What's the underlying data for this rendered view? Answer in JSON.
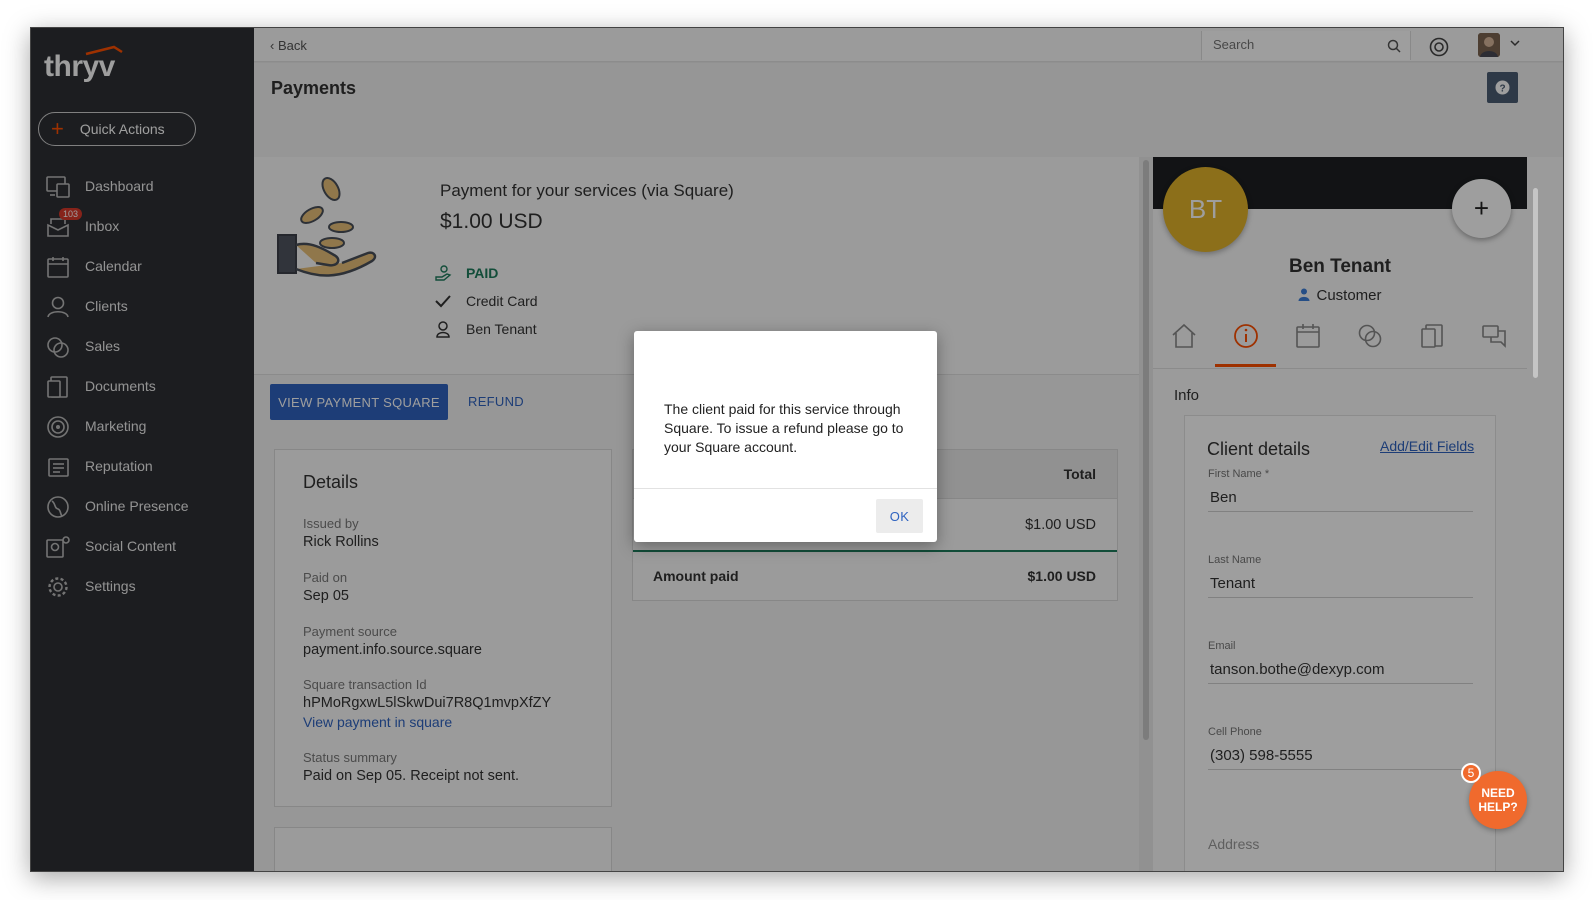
{
  "app": {
    "logo_text": "thryv"
  },
  "sidebar": {
    "quick_actions_label": "Quick Actions",
    "items": [
      {
        "label": "Dashboard",
        "icon": "dashboard-icon"
      },
      {
        "label": "Inbox",
        "icon": "inbox-icon",
        "badge": "103"
      },
      {
        "label": "Calendar",
        "icon": "calendar-icon"
      },
      {
        "label": "Clients",
        "icon": "clients-icon"
      },
      {
        "label": "Sales",
        "icon": "sales-icon"
      },
      {
        "label": "Documents",
        "icon": "documents-icon"
      },
      {
        "label": "Marketing",
        "icon": "marketing-icon"
      },
      {
        "label": "Reputation",
        "icon": "reputation-icon"
      },
      {
        "label": "Online Presence",
        "icon": "globe-icon"
      },
      {
        "label": "Social Content",
        "icon": "social-content-icon"
      },
      {
        "label": "Settings",
        "icon": "gear-icon"
      }
    ]
  },
  "topbar": {
    "back_label": "Back",
    "search_placeholder": "Search"
  },
  "page": {
    "title": "Payments"
  },
  "payment": {
    "title": "Payment for your services (via Square)",
    "amount": "$1.00 USD",
    "status": "PAID",
    "method": "Credit Card",
    "client": "Ben Tenant",
    "view_button": "VIEW PAYMENT SQUARE",
    "refund_button": "REFUND"
  },
  "details": {
    "title": "Details",
    "issued_by_label": "Issued by",
    "issued_by": "Rick Rollins",
    "paid_on_label": "Paid on",
    "paid_on": "Sep 05",
    "source_label": "Payment source",
    "source": "payment.info.source.square",
    "txn_label": "Square transaction Id",
    "txn_id": "hPMoRgxwL5lSkwDui7R8Q1mvpXfZY",
    "view_link": "View payment in square",
    "status_label": "Status summary",
    "status_summary": "Paid on Sep 05. Receipt not sent."
  },
  "totals": {
    "header": "Total",
    "row_value": "$1.00 USD",
    "amount_paid_label": "Amount paid",
    "amount_paid": "$1.00 USD"
  },
  "client_panel": {
    "initials": "BT",
    "name": "Ben Tenant",
    "role": "Customer",
    "info_title": "Info",
    "card_title": "Client details",
    "card_link": "Add/Edit Fields",
    "fields": {
      "first_name_label": "First Name *",
      "first_name": "Ben",
      "last_name_label": "Last Name",
      "last_name": "Tenant",
      "email_label": "Email",
      "email": "tanson.bothe@dexyp.com",
      "cell_label": "Cell Phone",
      "cell": "(303) 598-5555",
      "address_label": "Address"
    }
  },
  "help_widget": {
    "label_line1": "NEED",
    "label_line2": "HELP?",
    "badge": "5"
  },
  "modal": {
    "message": "The client paid for this service through Square. To issue a refund please go to your Square account.",
    "ok_label": "OK"
  },
  "colors": {
    "accent_orange": "#ff5000",
    "primary_blue": "#2f63c0",
    "paid_green": "#1e7d5d",
    "avatar_gold": "#e3b32a",
    "sidebar_bg": "#2e3035"
  }
}
